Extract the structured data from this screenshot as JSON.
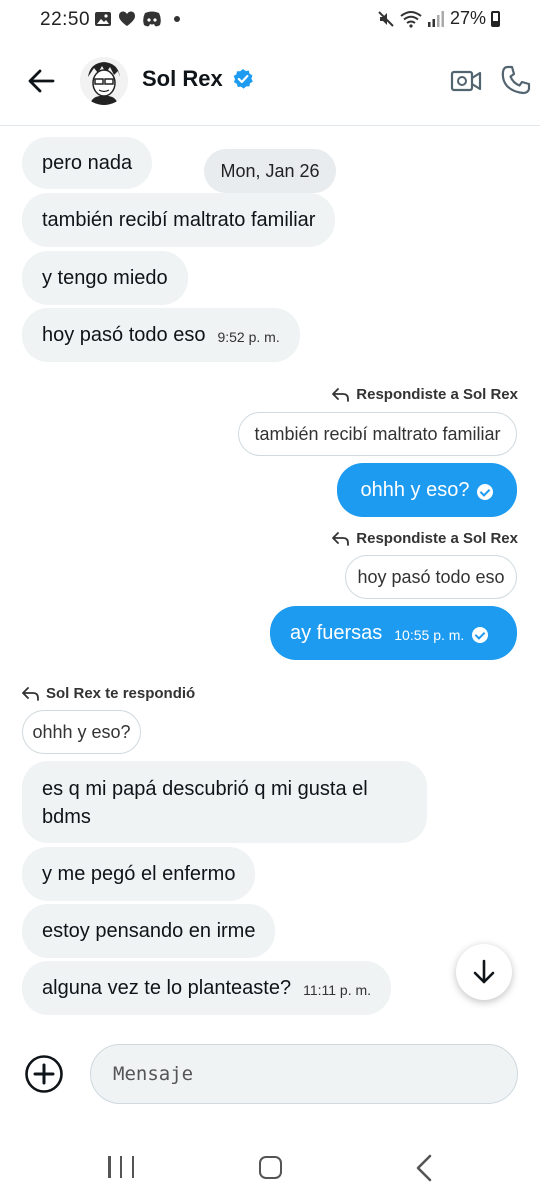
{
  "status_bar": {
    "time": "22:50",
    "battery": "27%"
  },
  "header": {
    "contact_name": "Sol Rex",
    "verified": true
  },
  "date_chip": "Mon, Jan 26",
  "messages": {
    "in1": {
      "text": "pero nada"
    },
    "in2": {
      "text": "también recibí maltrato familiar"
    },
    "in3": {
      "text": "y tengo miedo"
    },
    "in4": {
      "text": "hoy pasó todo eso",
      "time": "9:52 p. m."
    },
    "reply1": {
      "label": "Respondiste a Sol Rex",
      "quote": "también recibí maltrato familiar"
    },
    "out1": {
      "text": "ohhh y eso?"
    },
    "reply2": {
      "label": "Respondiste a Sol Rex",
      "quote": "hoy pasó todo eso"
    },
    "out2": {
      "text": "ay fuersas",
      "time": "10:55 p. m."
    },
    "reply3": {
      "label": "Sol Rex te respondió",
      "quote": "ohhh y eso?"
    },
    "in5": {
      "line1": "es q mi papá descubrió q mi gusta el",
      "line2": "bdms"
    },
    "in6": {
      "text": "y me pegó el enfermo"
    },
    "in7": {
      "text": "estoy pensando en irme"
    },
    "in8": {
      "text": "alguna vez te lo planteaste?",
      "time": "11:11 p. m."
    }
  },
  "composer": {
    "placeholder": "Mensaje"
  },
  "colors": {
    "accent": "#1d9bf0",
    "incoming_bubble": "#eff3f4"
  },
  "icons": [
    "back-arrow-icon",
    "verified-badge-icon",
    "video-camera-icon",
    "phone-icon",
    "reply-arrow-icon",
    "read-check-icon",
    "arrow-down-icon",
    "add-circle-icon"
  ]
}
